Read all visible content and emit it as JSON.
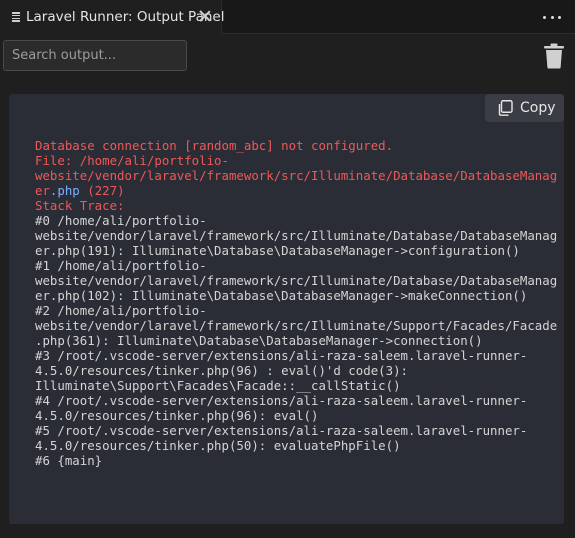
{
  "tab": {
    "title": "Laravel Runner: Output Panel"
  },
  "toolbar": {
    "search_placeholder": "Search output...",
    "copy_label": "Copy"
  },
  "output": {
    "error_message": "Database connection [random_abc] not configured.",
    "file_label": "File: /home/ali/portfolio-",
    "file_line2": "website/vendor/laravel/framework/src/Illuminate/Database/DatabaseManag",
    "file_line3_prefix": "er",
    "file_ext": ".php",
    "file_line_no": "(227)",
    "stack_label": "Stack Trace:",
    "trace_lines": [
      "#0 /home/ali/portfolio-",
      "website/vendor/laravel/framework/src/Illuminate/Database/DatabaseManag",
      "er.php(191): Illuminate\\Database\\DatabaseManager->configuration()",
      "#1 /home/ali/portfolio-",
      "website/vendor/laravel/framework/src/Illuminate/Database/DatabaseManag",
      "er.php(102): Illuminate\\Database\\DatabaseManager->makeConnection()",
      "#2 /home/ali/portfolio-",
      "website/vendor/laravel/framework/src/Illuminate/Support/Facades/Facade",
      ".php(361): Illuminate\\Database\\DatabaseManager->connection()",
      "#3 /root/.vscode-server/extensions/ali-raza-saleem.laravel-runner-",
      "4.5.0/resources/tinker.php(96) : eval()'d code(3):",
      "Illuminate\\Support\\Facades\\Facade::__callStatic()",
      "#4 /root/.vscode-server/extensions/ali-raza-saleem.laravel-runner-",
      "4.5.0/resources/tinker.php(96): eval()",
      "#5 /root/.vscode-server/extensions/ali-raza-saleem.laravel-runner-",
      "4.5.0/resources/tinker.php(50): evaluatePhpFile()",
      "#6 {main}"
    ]
  },
  "icons": {
    "tab": "output-lines-icon",
    "close": "close-icon",
    "more": "ellipsis-icon",
    "clear": "trash-icon",
    "copy": "copy-icon"
  },
  "colors": {
    "error": "#ef5858",
    "file_ext": "#7fb1ff",
    "panel_bg": "#2a2d35",
    "text": "#d4d4d4"
  }
}
